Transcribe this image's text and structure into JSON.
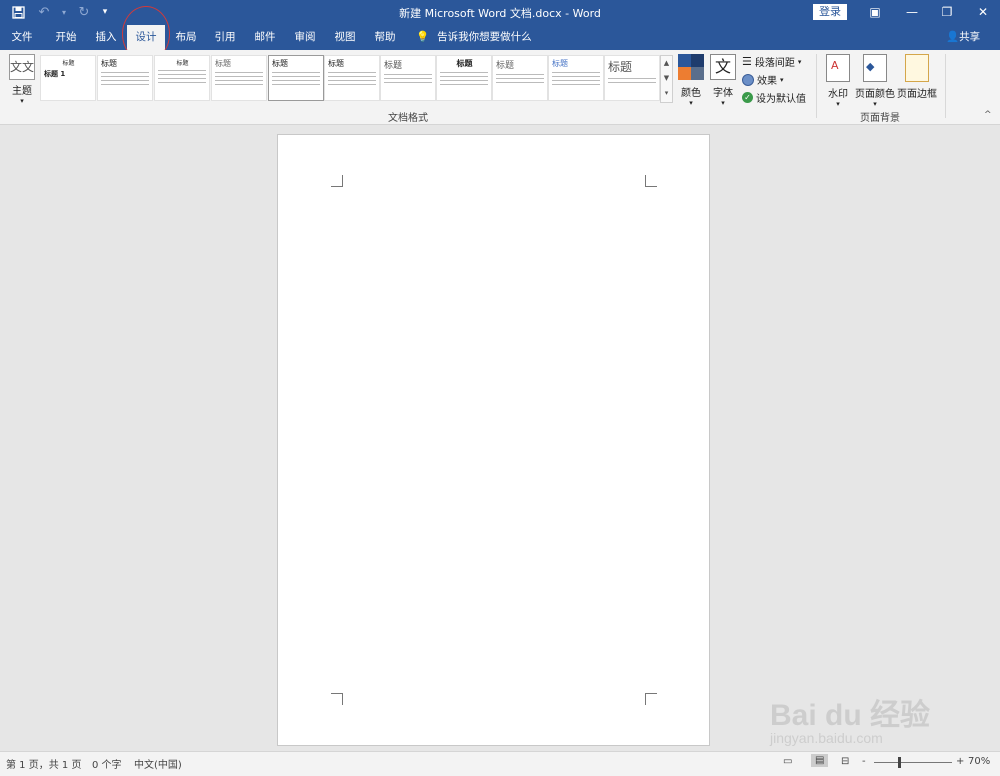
{
  "window": {
    "title": "新建 Microsoft Word 文档.docx  -  Word",
    "login_label": "登录",
    "save_icon": "save-icon",
    "undo_icon": "undo-icon",
    "redo_icon": "redo-icon"
  },
  "tabs": [
    {
      "label": "文件"
    },
    {
      "label": "开始"
    },
    {
      "label": "插入"
    },
    {
      "label": "设计",
      "active": true
    },
    {
      "label": "布局"
    },
    {
      "label": "引用"
    },
    {
      "label": "邮件"
    },
    {
      "label": "审阅"
    },
    {
      "label": "视图"
    },
    {
      "label": "帮助"
    }
  ],
  "tellme": "告诉我你想要做什么",
  "share": "共享",
  "ribbon": {
    "theme_label": "主题",
    "theme_icon_text": "文文",
    "styles": [
      {
        "heading": "标题"
      },
      {
        "heading": "标题"
      },
      {
        "heading": "标题"
      },
      {
        "heading": "标题"
      },
      {
        "heading": "标题"
      },
      {
        "heading": "标题"
      },
      {
        "heading": "标题"
      },
      {
        "heading": "标题"
      },
      {
        "heading": "标题"
      },
      {
        "heading": "标题"
      },
      {
        "heading": "标题"
      }
    ],
    "style_thumb_first_sub": "标题 1",
    "doc_format_label": "文档格式",
    "colors_label": "颜色",
    "fonts_label": "字体",
    "fonts_icon_text": "文",
    "para_spacing_label": "段落间距",
    "effects_label": "效果",
    "set_default_label": "设为默认值",
    "watermark_label": "水印",
    "page_color_label": "页面颜色",
    "page_border_label": "页面边框",
    "page_bg_label": "页面背景",
    "accent_colors": [
      "#2b579a",
      "#2f4f8c",
      "#ed7d31",
      "#5a6e8c"
    ]
  },
  "status": {
    "page_info": "第 1 页，共 1 页",
    "word_count": "0 个字",
    "language": "中文(中国)",
    "zoom": "70%",
    "zoom_minus": "-",
    "zoom_plus": "+"
  },
  "watermark": {
    "text": "Bai du 经验",
    "url": "jingyan.baidu.com"
  }
}
